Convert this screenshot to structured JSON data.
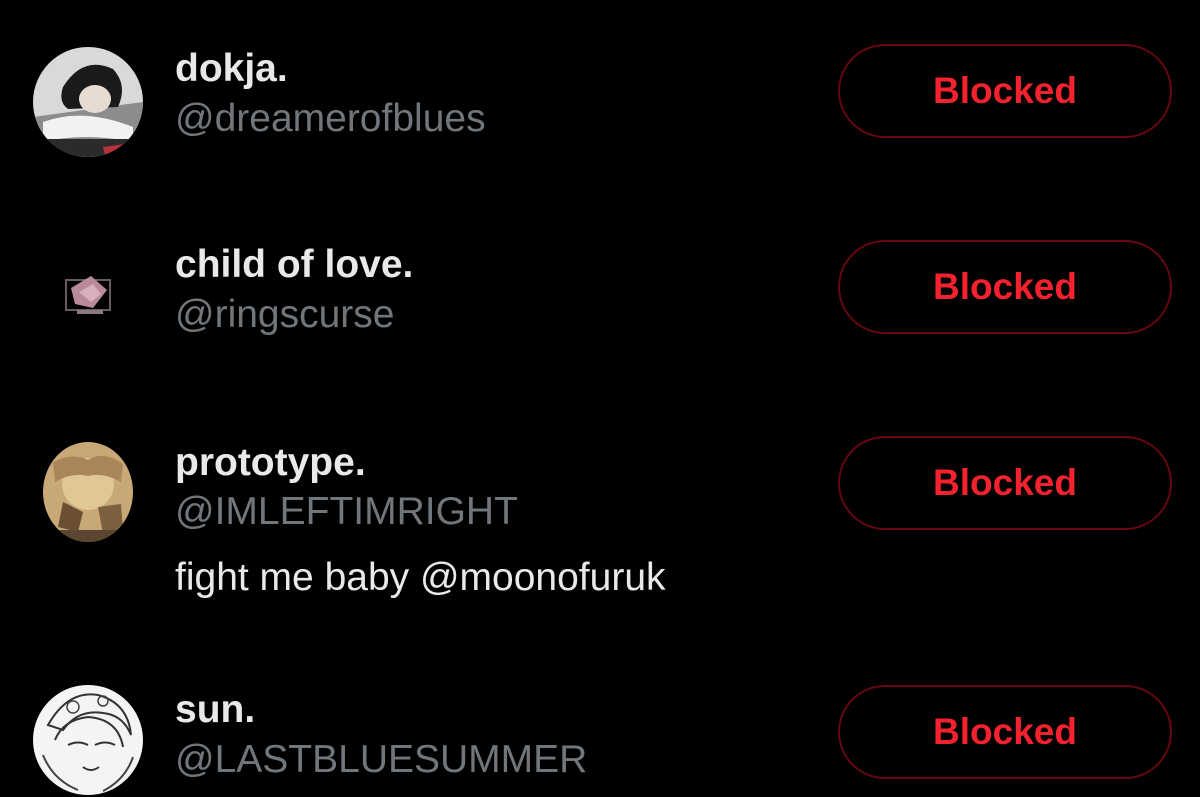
{
  "colors": {
    "background": "#000000",
    "name_text": "#e7e9ea",
    "handle_text": "#71767b",
    "blocked_text": "#f4212e",
    "blocked_border": "#67070f"
  },
  "accounts": [
    {
      "display_name": "dokja.",
      "handle": "@dreamerofblues",
      "bio": "",
      "button_label": "Blocked"
    },
    {
      "display_name": "child of love.",
      "handle": "@ringscurse",
      "bio": "",
      "button_label": "Blocked"
    },
    {
      "display_name": "prototype.",
      "handle": "@IMLEFTIMRIGHT",
      "bio": "fight me baby @moonofuruk",
      "button_label": "Blocked"
    },
    {
      "display_name": "sun.",
      "handle": "@LASTBLUESUMMER",
      "bio": "",
      "button_label": "Blocked"
    }
  ]
}
